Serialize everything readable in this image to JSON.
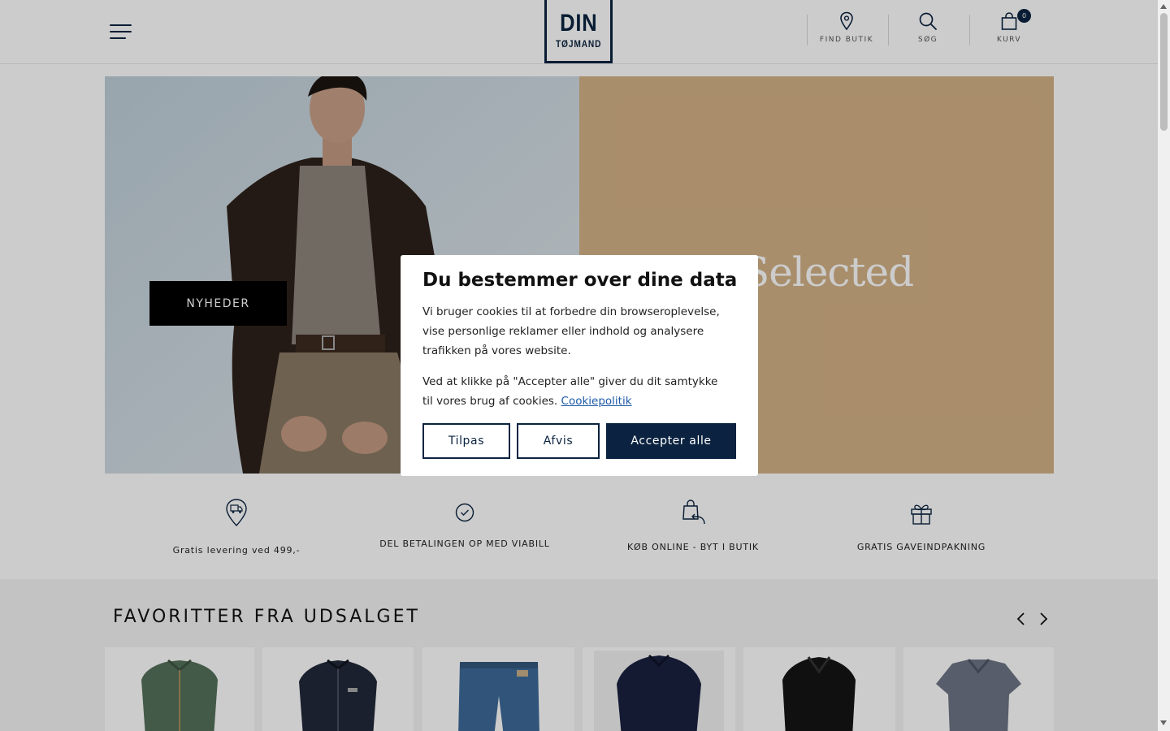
{
  "header": {
    "logo_top": "DIN",
    "logo_bottom": "TØJMAND",
    "find_store_label": "FIND BUTIK",
    "search_label": "SØG",
    "cart_label": "KURV",
    "cart_count": "0",
    "brand_color": "#0b2340"
  },
  "hero": {
    "cta_label": "NYHEDER",
    "right_brand_text": "Selected"
  },
  "usps": [
    {
      "icon": "delivery-pin-icon",
      "text": "Gratis levering ved 499,-"
    },
    {
      "icon": "check-circle-icon",
      "text": "DEL BETALINGEN OP MED VIABILL"
    },
    {
      "icon": "bag-return-icon",
      "text": "KØB ONLINE - BYT I BUTIK"
    },
    {
      "icon": "gift-icon",
      "text": "GRATIS GAVEINDPAKNING"
    }
  ],
  "favorites": {
    "title": "FAVORITTER FRA UDSALGET",
    "products": [
      {
        "icon": "green-zip-jacket"
      },
      {
        "icon": "navy-zip-jacket"
      },
      {
        "icon": "blue-jeans"
      },
      {
        "icon": "navy-overshirt"
      },
      {
        "icon": "black-coat"
      },
      {
        "icon": "grey-polo-shirt"
      }
    ]
  },
  "cookie_modal": {
    "title": "Du bestemmer over dine data",
    "paragraph_1": "Vi bruger cookies til at forbedre din browseroplevelse, vise personlige reklamer eller indhold og analysere trafikken på vores website.",
    "paragraph_2": "Ved at klikke på \"Accepter alle\"  giver du dit samtykke til vores brug af cookies.",
    "policy_link": "Cookiepolitik",
    "customize_button": "Tilpas",
    "reject_button": "Afvis",
    "accept_button": "Accepter alle"
  }
}
